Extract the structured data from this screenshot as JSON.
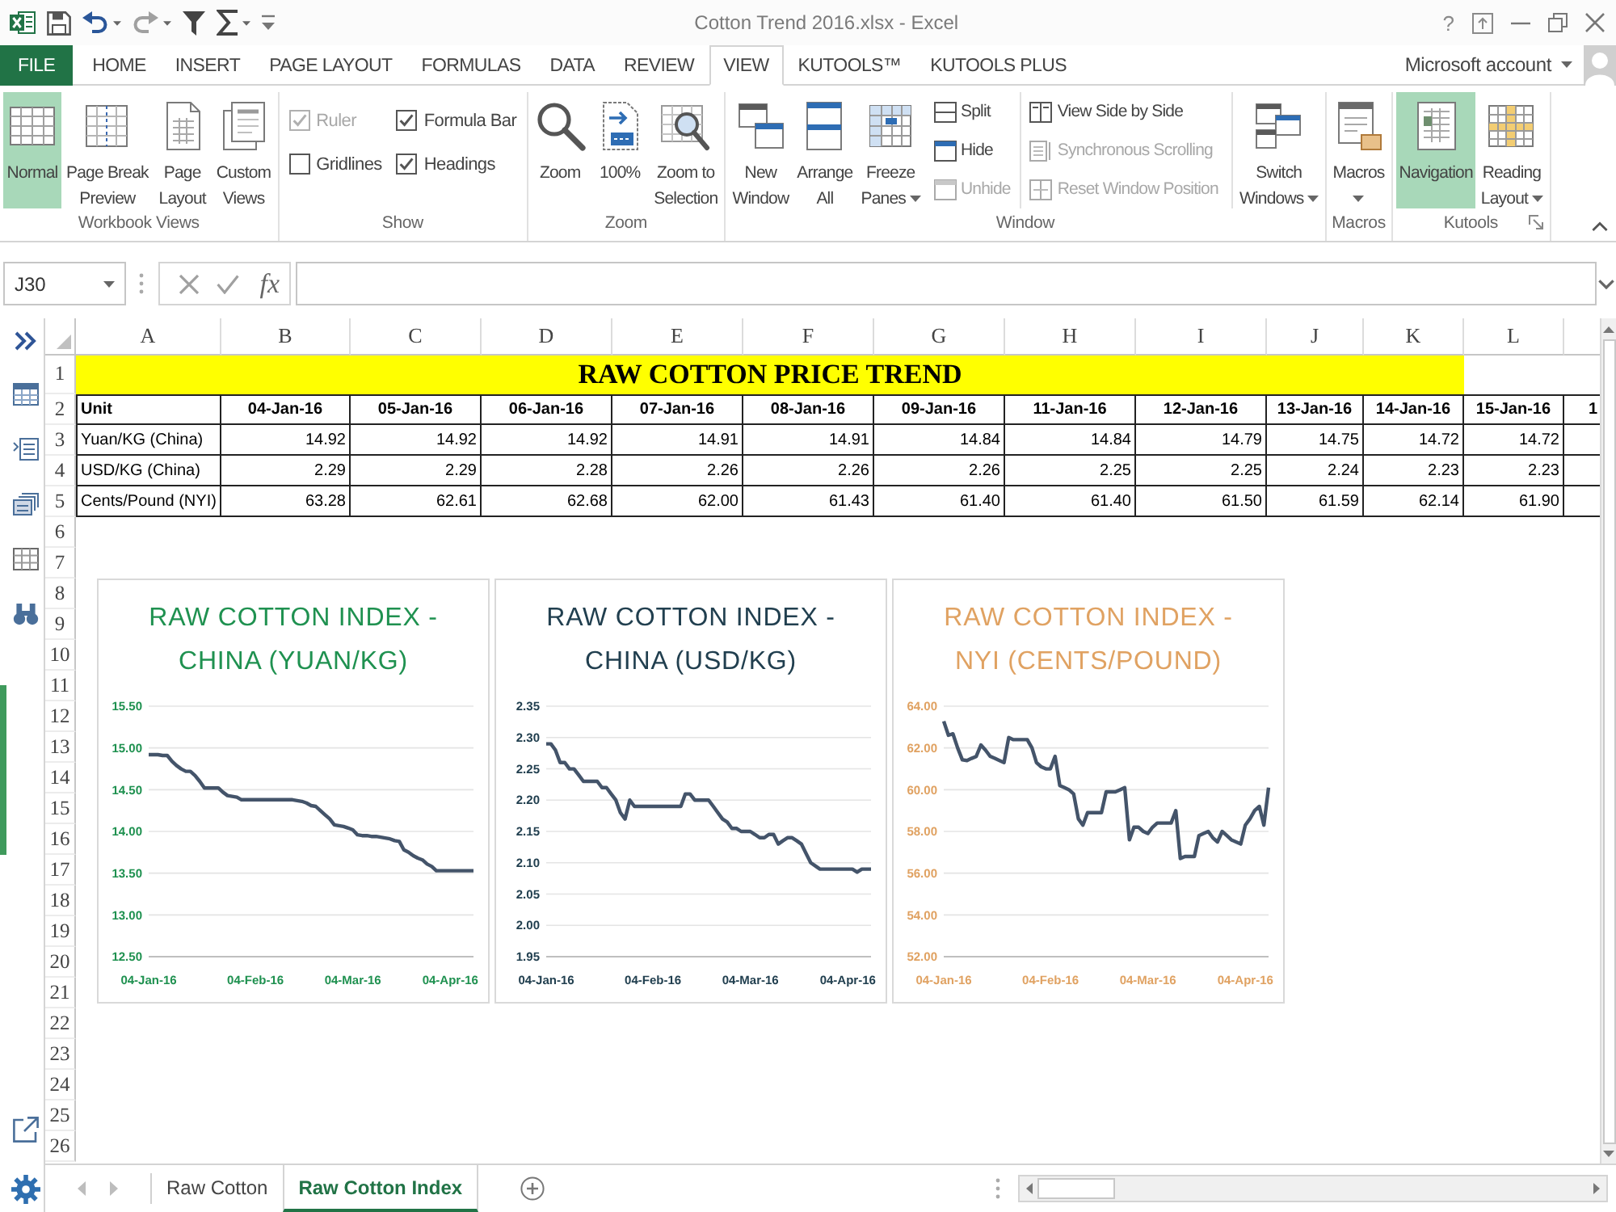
{
  "window": {
    "title": "Cotton Trend 2016.xlsx - Excel",
    "help": "?"
  },
  "ribbon_tabs": [
    {
      "label": "FILE",
      "kind": "backstage",
      "selected": false
    },
    {
      "label": "HOME",
      "kind": "tab",
      "selected": false
    },
    {
      "label": "INSERT",
      "kind": "tab",
      "selected": false
    },
    {
      "label": "PAGE LAYOUT",
      "kind": "tab",
      "selected": false
    },
    {
      "label": "FORMULAS",
      "kind": "tab",
      "selected": false
    },
    {
      "label": "DATA",
      "kind": "tab",
      "selected": false
    },
    {
      "label": "REVIEW",
      "kind": "tab",
      "selected": false
    },
    {
      "label": "VIEW",
      "kind": "tab",
      "selected": true
    },
    {
      "label": "KUTOOLS™",
      "kind": "tab",
      "selected": false
    },
    {
      "label": "KUTOOLS PLUS",
      "kind": "tab",
      "selected": false
    }
  ],
  "account": {
    "label": "Microsoft account"
  },
  "ribbon_groups": [
    {
      "label": "Workbook Views",
      "dialog_launcher": false,
      "items": [
        {
          "kind": "large",
          "label": "Normal",
          "selected": true,
          "dropdown": false
        },
        {
          "kind": "large",
          "label": "Page Break\nPreview",
          "selected": false,
          "dropdown": false
        },
        {
          "kind": "large",
          "label": "Page\nLayout",
          "selected": false,
          "dropdown": false
        },
        {
          "kind": "large",
          "label": "Custom\nViews",
          "selected": false,
          "dropdown": false
        }
      ]
    },
    {
      "label": "Show",
      "dialog_launcher": false,
      "items": [
        {
          "kind": "check",
          "label": "Ruler",
          "checked": true,
          "disabled": true
        },
        {
          "kind": "check",
          "label": "Formula Bar",
          "checked": true,
          "disabled": false
        },
        {
          "kind": "check",
          "label": "Gridlines",
          "checked": false,
          "disabled": false
        },
        {
          "kind": "check",
          "label": "Headings",
          "checked": true,
          "disabled": false
        }
      ]
    },
    {
      "label": "Zoom",
      "dialog_launcher": false,
      "items": [
        {
          "kind": "large",
          "label": "Zoom",
          "selected": false,
          "dropdown": false
        },
        {
          "kind": "large",
          "label": "100%",
          "selected": false,
          "dropdown": false
        },
        {
          "kind": "large",
          "label": "Zoom to\nSelection",
          "selected": false,
          "dropdown": false
        }
      ]
    },
    {
      "label": "Window",
      "dialog_launcher": false,
      "items": [
        {
          "kind": "large",
          "label": "New\nWindow",
          "selected": false,
          "dropdown": false
        },
        {
          "kind": "large",
          "label": "Arrange\nAll",
          "selected": false,
          "dropdown": false
        },
        {
          "kind": "large",
          "label": "Freeze\nPanes",
          "selected": false,
          "dropdown": true
        },
        {
          "kind": "small",
          "label": "Split",
          "disabled": false
        },
        {
          "kind": "small",
          "label": "Hide",
          "disabled": false
        },
        {
          "kind": "small",
          "label": "Unhide",
          "disabled": true
        },
        {
          "kind": "small",
          "label": "View Side by Side",
          "disabled": false
        },
        {
          "kind": "small",
          "label": "Synchronous Scrolling",
          "disabled": true
        },
        {
          "kind": "small",
          "label": "Reset Window Position",
          "disabled": true
        },
        {
          "kind": "large",
          "label": "Switch\nWindows",
          "selected": false,
          "dropdown": true
        }
      ]
    },
    {
      "label": "Macros",
      "dialog_launcher": false,
      "items": [
        {
          "kind": "large",
          "label": "Macros",
          "selected": false,
          "dropdown": true
        }
      ]
    },
    {
      "label": "Kutools",
      "dialog_launcher": true,
      "items": [
        {
          "kind": "large",
          "label": "Navigation",
          "selected": true,
          "dropdown": false
        },
        {
          "kind": "large",
          "label": "Reading\nLayout",
          "selected": false,
          "dropdown": true
        }
      ]
    }
  ],
  "formula_bar": {
    "name_box": "J30",
    "insert_function": "fx"
  },
  "sheet": {
    "columns": [
      "A",
      "B",
      "C",
      "D",
      "E",
      "F",
      "G",
      "H",
      "I",
      "J",
      "K",
      "L"
    ],
    "rows": [
      "1",
      "2",
      "3",
      "4",
      "5",
      "6",
      "7",
      "8",
      "9",
      "10",
      "11",
      "12",
      "13",
      "14",
      "15",
      "16",
      "17",
      "18",
      "19",
      "20",
      "21",
      "22",
      "23",
      "24",
      "25",
      "26"
    ],
    "title": "RAW COTTON PRICE TREND",
    "table": {
      "header": [
        "Unit",
        "04-Jan-16",
        "05-Jan-16",
        "06-Jan-16",
        "07-Jan-16",
        "08-Jan-16",
        "09-Jan-16",
        "11-Jan-16",
        "12-Jan-16",
        "13-Jan-16",
        "14-Jan-16",
        "15-Jan-16",
        "1"
      ],
      "rows": [
        [
          "Yuan/KG (China)",
          "14.92",
          "14.92",
          "14.92",
          "14.91",
          "14.91",
          "14.84",
          "14.84",
          "14.79",
          "14.75",
          "14.72",
          "14.72"
        ],
        [
          "USD/KG (China)",
          "2.29",
          "2.29",
          "2.28",
          "2.26",
          "2.26",
          "2.26",
          "2.25",
          "2.25",
          "2.24",
          "2.23",
          "2.23"
        ],
        [
          "Cents/Pound (NYI)",
          "63.28",
          "62.61",
          "62.68",
          "62.00",
          "61.43",
          "61.40",
          "61.40",
          "61.50",
          "61.59",
          "62.14",
          "61.90"
        ]
      ]
    }
  },
  "charts": [
    {
      "color": "#1f9150",
      "chart_data": {
        "type": "line",
        "title": "RAW COTTON INDEX -\nCHINA (YUAN/KG)",
        "grid": true,
        "categories": [
          "04-Jan-16",
          null,
          null,
          null,
          null,
          null,
          null,
          null,
          null,
          null,
          null,
          null,
          null,
          null,
          null,
          null,
          null,
          null,
          null,
          null,
          null,
          null,
          null,
          "04-Feb-16",
          null,
          null,
          null,
          null,
          null,
          null,
          null,
          null,
          null,
          null,
          null,
          null,
          null,
          null,
          null,
          null,
          null,
          null,
          null,
          null,
          "04-Mar-16",
          null,
          null,
          null,
          null,
          null,
          null,
          null,
          null,
          null,
          null,
          null,
          null,
          null,
          null,
          null,
          null,
          null,
          null,
          null,
          null,
          "04-Apr-16",
          null,
          null,
          null,
          null,
          null
        ],
        "ylim": [
          12.5,
          15.5
        ],
        "yticks": [
          {
            "value": 12.5,
            "label": "12.50"
          },
          {
            "value": 13,
            "label": "13.00"
          },
          {
            "value": 13.5,
            "label": "13.50"
          },
          {
            "value": 14,
            "label": "14.00"
          },
          {
            "value": 14.5,
            "label": "14.50"
          },
          {
            "value": 15,
            "label": "15.00"
          },
          {
            "value": 15.5,
            "label": "15.50"
          }
        ],
        "series": [
          {
            "color": "#44546a",
            "values": [
              14.92,
              14.92,
              14.92,
              14.91,
              14.91,
              14.84,
              14.79,
              14.75,
              14.72,
              14.72,
              14.67,
              14.6,
              14.52,
              14.52,
              14.52,
              14.52,
              14.47,
              14.43,
              14.42,
              14.41,
              14.38,
              14.38,
              14.38,
              14.38,
              14.38,
              14.38,
              14.38,
              14.38,
              14.38,
              14.38,
              14.38,
              14.38,
              14.37,
              14.36,
              14.34,
              14.31,
              14.3,
              14.25,
              14.2,
              14.15,
              14.08,
              14.07,
              14.06,
              14.04,
              14.02,
              13.96,
              13.95,
              13.95,
              13.94,
              13.94,
              13.93,
              13.92,
              13.91,
              13.89,
              13.88,
              13.78,
              13.75,
              13.71,
              13.68,
              13.66,
              13.61,
              13.58,
              13.53,
              13.53,
              13.53,
              13.53,
              13.53,
              13.53,
              13.53,
              13.53,
              13.53
            ]
          }
        ]
      }
    },
    {
      "color": "#213f4f",
      "chart_data": {
        "type": "line",
        "title": "RAW COTTON INDEX -\nCHINA (USD/KG)",
        "grid": true,
        "categories": [
          "04-Jan-16",
          null,
          null,
          null,
          null,
          null,
          null,
          null,
          null,
          null,
          null,
          null,
          null,
          null,
          null,
          null,
          null,
          null,
          null,
          null,
          null,
          null,
          null,
          "04-Feb-16",
          null,
          null,
          null,
          null,
          null,
          null,
          null,
          null,
          null,
          null,
          null,
          null,
          null,
          null,
          null,
          null,
          null,
          null,
          null,
          null,
          "04-Mar-16",
          null,
          null,
          null,
          null,
          null,
          null,
          null,
          null,
          null,
          null,
          null,
          null,
          null,
          null,
          null,
          null,
          null,
          null,
          null,
          null,
          "04-Apr-16",
          null,
          null,
          null,
          null,
          null
        ],
        "ylim": [
          1.95,
          2.35
        ],
        "yticks": [
          {
            "value": 1.95,
            "label": "1.95"
          },
          {
            "value": 2,
            "label": "2.00"
          },
          {
            "value": 2.05,
            "label": "2.05"
          },
          {
            "value": 2.1,
            "label": "2.10"
          },
          {
            "value": 2.15,
            "label": "2.15"
          },
          {
            "value": 2.2,
            "label": "2.20"
          },
          {
            "value": 2.25,
            "label": "2.25"
          },
          {
            "value": 2.3,
            "label": "2.30"
          },
          {
            "value": 2.35,
            "label": "2.35"
          }
        ],
        "series": [
          {
            "color": "#44546a",
            "values": [
              2.29,
              2.29,
              2.28,
              2.26,
              2.26,
              2.25,
              2.25,
              2.24,
              2.23,
              2.23,
              2.23,
              2.23,
              2.22,
              2.22,
              2.21,
              2.2,
              2.18,
              2.17,
              2.2,
              2.19,
              2.19,
              2.19,
              2.19,
              2.19,
              2.19,
              2.19,
              2.19,
              2.19,
              2.19,
              2.19,
              2.21,
              2.21,
              2.2,
              2.2,
              2.2,
              2.2,
              2.19,
              2.18,
              2.17,
              2.165,
              2.155,
              2.155,
              2.15,
              2.15,
              2.15,
              2.145,
              2.14,
              2.14,
              2.145,
              2.145,
              2.13,
              2.135,
              2.14,
              2.14,
              2.135,
              2.13,
              2.115,
              2.1,
              2.095,
              2.09,
              2.09,
              2.09,
              2.09,
              2.09,
              2.09,
              2.09,
              2.09,
              2.085,
              2.09,
              2.09,
              2.09
            ]
          }
        ]
      }
    },
    {
      "color": "#e0a262",
      "chart_data": {
        "type": "line",
        "title": "RAW COTTON INDEX -\nNYI (CENTS/POUND)",
        "grid": true,
        "categories": [
          "04-Jan-16",
          null,
          null,
          null,
          null,
          null,
          null,
          null,
          null,
          null,
          null,
          null,
          null,
          null,
          null,
          null,
          null,
          null,
          null,
          null,
          null,
          null,
          null,
          "04-Feb-16",
          null,
          null,
          null,
          null,
          null,
          null,
          null,
          null,
          null,
          null,
          null,
          null,
          null,
          null,
          null,
          null,
          null,
          null,
          null,
          null,
          "04-Mar-16",
          null,
          null,
          null,
          null,
          null,
          null,
          null,
          null,
          null,
          null,
          null,
          null,
          null,
          null,
          null,
          null,
          null,
          null,
          null,
          null,
          "04-Apr-16",
          null,
          null,
          null,
          null,
          null
        ],
        "ylim": [
          52,
          64
        ],
        "yticks": [
          {
            "value": 52,
            "label": "52.00"
          },
          {
            "value": 54,
            "label": "54.00"
          },
          {
            "value": 56,
            "label": "56.00"
          },
          {
            "value": 58,
            "label": "58.00"
          },
          {
            "value": 60,
            "label": "60.00"
          },
          {
            "value": 62,
            "label": "62.00"
          },
          {
            "value": 64,
            "label": "64.00"
          }
        ],
        "series": [
          {
            "color": "#44546a",
            "values": [
              63.28,
              62.61,
              62.68,
              62.0,
              61.43,
              61.4,
              61.5,
              61.59,
              62.14,
              61.9,
              61.6,
              61.5,
              61.4,
              61.3,
              62.5,
              62.4,
              62.4,
              62.4,
              62.4,
              62.0,
              61.3,
              61.1,
              61.0,
              61.0,
              61.6,
              60.2,
              60.1,
              60.0,
              59.8,
              58.6,
              58.3,
              58.9,
              58.9,
              58.9,
              58.9,
              59.9,
              59.9,
              59.9,
              60.0,
              60.1,
              57.6,
              58.2,
              58.2,
              58.0,
              57.9,
              58.2,
              58.4,
              58.4,
              58.4,
              58.4,
              59.0,
              56.7,
              56.8,
              56.8,
              56.8,
              57.8,
              57.9,
              58.0,
              57.7,
              57.5,
              58.0,
              57.8,
              57.6,
              57.5,
              57.4,
              58.3,
              58.6,
              59.0,
              59.2,
              58.3,
              60.1
            ]
          }
        ]
      }
    }
  ],
  "sheet_tabs": [
    {
      "label": "Raw Cotton",
      "selected": false
    },
    {
      "label": "Raw Cotton Index",
      "selected": true
    }
  ]
}
